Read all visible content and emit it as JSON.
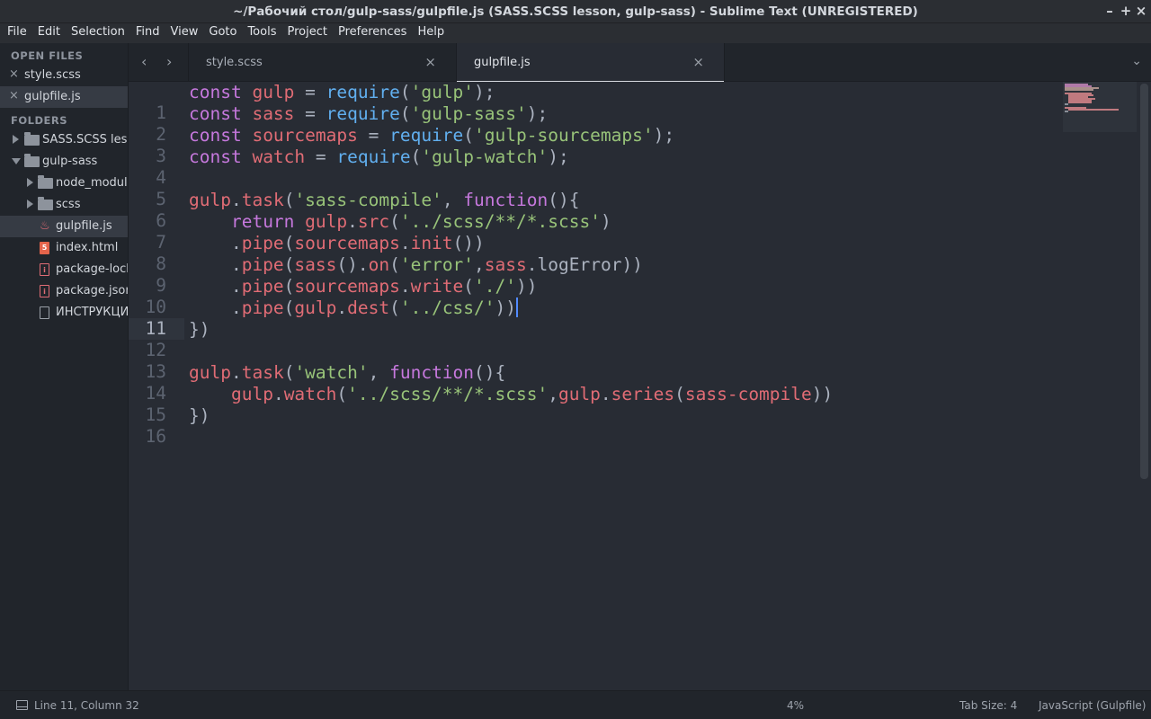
{
  "window": {
    "title": "~/Рабочий стол/gulp-sass/gulpfile.js (SASS.SCSS lesson, gulp-sass) - Sublime Text (UNREGISTERED)",
    "minimize": "–",
    "maximize": "+",
    "close": "×"
  },
  "menu": [
    "File",
    "Edit",
    "Selection",
    "Find",
    "View",
    "Goto",
    "Tools",
    "Project",
    "Preferences",
    "Help"
  ],
  "sidebar": {
    "open_files_heading": "OPEN FILES",
    "open_files": [
      {
        "label": "style.scss",
        "close": "×"
      },
      {
        "label": "gulpfile.js",
        "close": "×"
      }
    ],
    "folders_heading": "FOLDERS",
    "folders": [
      {
        "label": "SASS.SCSS lesson"
      },
      {
        "label": "gulp-sass"
      },
      {
        "label": "node_modules"
      },
      {
        "label": "scss"
      },
      {
        "label": "gulpfile.js"
      },
      {
        "label": "index.html"
      },
      {
        "label": "package-lock.json"
      },
      {
        "label": "package.json"
      },
      {
        "label": "ИНСТРУКЦИЯ"
      }
    ]
  },
  "tabs": [
    {
      "label": "style.scss",
      "close": "×"
    },
    {
      "label": "gulpfile.js",
      "close": "×"
    }
  ],
  "nav": {
    "back": "‹",
    "forward": "›",
    "menu": "⌄"
  },
  "editor": {
    "lines": [
      {
        "n": "1"
      },
      {
        "n": "2"
      },
      {
        "n": "3"
      },
      {
        "n": "4"
      },
      {
        "n": "5"
      },
      {
        "n": "6"
      },
      {
        "n": "7"
      },
      {
        "n": "8"
      },
      {
        "n": "9"
      },
      {
        "n": "10"
      },
      {
        "n": "11"
      },
      {
        "n": "12"
      },
      {
        "n": "13"
      },
      {
        "n": "14"
      },
      {
        "n": "15"
      },
      {
        "n": "16"
      }
    ],
    "tokens": {
      "const": "const",
      "require": "require",
      "return": "return",
      "function": "function",
      "gulp": "gulp",
      "sass": "sass",
      "sourcemaps": "sourcemaps",
      "watch": "watch",
      "s_gulp": "'gulp'",
      "s_gulp_sass": "'gulp-sass'",
      "s_gulp_sourcemaps": "'gulp-sourcemaps'",
      "s_gulp_watch": "'gulp-watch'",
      "s_sass_compile": "'sass-compile'",
      "s_scss_glob": "'../scss/**/*.scss'",
      "s_error": "'error'",
      "s_dot": "'./'",
      "s_css": "'../css/'",
      "s_watch": "'watch'",
      "task": "task",
      "src": "src",
      "pipe": "pipe",
      "init": "init",
      "on": "on",
      "logError": "logError",
      "write": "write",
      "dest": "dest",
      "series": "series",
      "sass_compile_id": "sass-compile"
    },
    "cursor": {
      "line": 11,
      "column": 32
    }
  },
  "status": {
    "position": "Line 11, Column 32",
    "percent": "4%",
    "tab_size": "Tab Size: 4",
    "syntax": "JavaScript (Gulpfile)"
  },
  "colors": {
    "keyword": "#c678dd",
    "variable": "#e06c75",
    "string": "#98c379",
    "function": "#61afef",
    "background": "#282c34",
    "sidebar": "#21252b"
  }
}
